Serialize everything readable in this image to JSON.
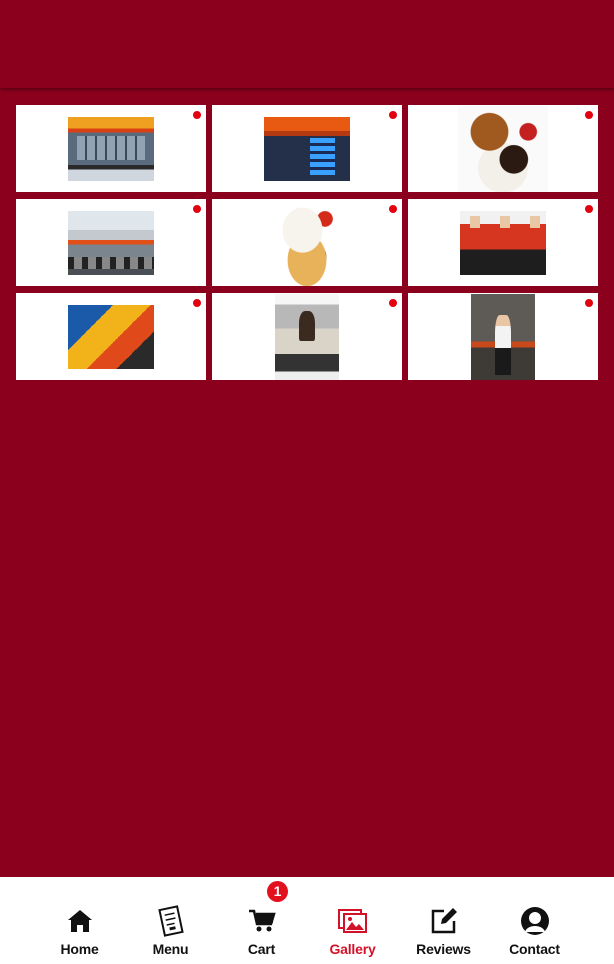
{
  "gallery": {
    "tiles": [
      {
        "icon": "storefront-photo"
      },
      {
        "icon": "mall-storefront-photo"
      },
      {
        "icon": "fried-chicken-dish-photo"
      },
      {
        "icon": "street-view-photo"
      },
      {
        "icon": "chicken-steak-plate-photo"
      },
      {
        "icon": "staff-group-photo"
      },
      {
        "icon": "menu-poster-photo"
      },
      {
        "icon": "kitchen-chef-photo"
      },
      {
        "icon": "staff-member-photo"
      }
    ],
    "indicator_color": "#e3000f"
  },
  "nav": {
    "items": [
      {
        "label": "Home",
        "icon": "home-icon"
      },
      {
        "label": "Menu",
        "icon": "menu-book-icon"
      },
      {
        "label": "Cart",
        "icon": "cart-icon",
        "badge": "1"
      },
      {
        "label": "Gallery",
        "icon": "gallery-icon",
        "active": true
      },
      {
        "label": "Reviews",
        "icon": "edit-icon"
      },
      {
        "label": "Contact",
        "icon": "contact-icon"
      }
    ]
  },
  "colors": {
    "background": "#8b001c",
    "accent": "#d3122a",
    "badge": "#e3101e"
  }
}
